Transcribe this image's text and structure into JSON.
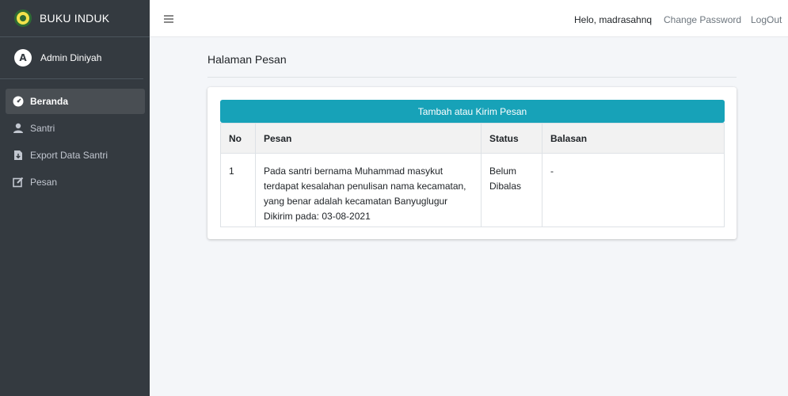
{
  "brand": {
    "title": "BUKU INDUK"
  },
  "user": {
    "avatar_letter": "A",
    "name": "Admin Diniyah"
  },
  "sidebar": {
    "items": [
      {
        "label": "Beranda",
        "icon": "tachometer-icon",
        "active": true
      },
      {
        "label": "Santri",
        "icon": "user-icon"
      },
      {
        "label": "Export Data Santri",
        "icon": "file-download-icon"
      },
      {
        "label": "Pesan",
        "icon": "edit-icon"
      }
    ]
  },
  "topbar": {
    "greeting": "Helo, madrasahnq",
    "change_password": "Change Password",
    "logout": "LogOut"
  },
  "page": {
    "title": "Halaman Pesan"
  },
  "panel": {
    "button_label": "Tambah atau Kirim Pesan",
    "columns": [
      "No",
      "Pesan",
      "Status",
      "Balasan"
    ],
    "rows": [
      {
        "no": "1",
        "message": "Pada santri bernama Muhammad masykut terdapat kesalahan penulisan nama kecamatan, yang benar adalah kecamatan Banyuglugur",
        "sent_at": "Dikirim pada: 03-08-2021",
        "status_line1": "Belum",
        "status_line2": "Dibalas",
        "reply": "-"
      }
    ]
  },
  "colors": {
    "sidebar": "#343a40",
    "accent": "#17a2b8",
    "background": "#f4f6f9"
  }
}
